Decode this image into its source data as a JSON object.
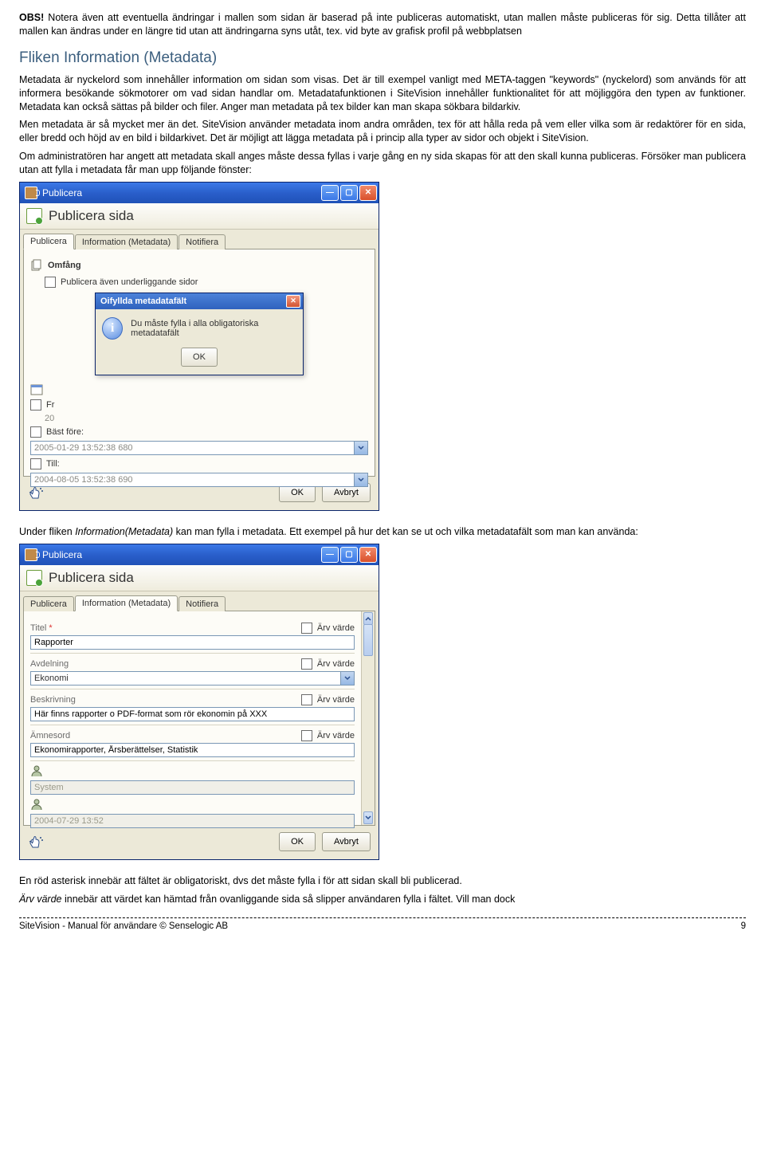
{
  "doc": {
    "p_obs_strong": "OBS!",
    "p_obs_rest": " Notera även att eventuella ändringar i mallen som sidan är baserad på inte publiceras automatiskt, utan mallen måste publiceras för sig. Detta tillåter att mallen kan ändras under en längre tid utan att ändringarna syns utåt, tex. vid byte av grafisk profil på webbplatsen",
    "h2_fliken": "Fliken Information (Metadata)",
    "p_meta_1": "Metadata är nyckelord som innehåller information om sidan som visas. Det är till exempel vanligt med META-taggen \"keywords\" (nyckelord) som används för att informera besökande sökmotorer om vad sidan handlar om. Metadatafunktionen i SiteVision innehåller funktionalitet för att möjliggöra den typen av funktioner. Metadata kan också sättas på bilder och filer. Anger man metadata på tex bilder kan man skapa sökbara bildarkiv.",
    "p_meta_2": "Men metadata är så mycket mer än det. SiteVision använder metadata inom andra områden, tex för att hålla reda på vem eller vilka som är redaktörer för en sida, eller bredd och höjd av en bild i bildarkivet. Det är möjligt att lägga metadata på i princip alla typer av sidor och objekt i SiteVision.",
    "p_meta_3": "Om administratören har angett att metadata skall anges måste dessa fyllas i varje gång en ny sida skapas för att den skall kunna publiceras. Försöker man publicera utan att fylla i metadata får man upp följande fönster:",
    "p_under_pre": "Under fliken ",
    "p_under_em": "Information(Metadata)",
    "p_under_post": " kan man fylla i metadata. Ett exempel på hur det kan se ut och vilka metadatafält som man kan använda:",
    "p_asterisk": "En röd asterisk innebär att fältet är obligatoriskt, dvs det måste fylla i för att sidan skall bli publicerad.",
    "p_arv_em": "Ärv värde",
    "p_arv_rest": " innebär att värdet kan hämtad från ovanliggande sida så slipper användaren fylla i fältet. Vill man dock"
  },
  "dialog": {
    "win_title": "Publicera",
    "sub_title": "Publicera sida",
    "tabs": {
      "publicera": "Publicera",
      "info": "Information (Metadata)",
      "notifiera": "Notifiera"
    },
    "omf_title": "Omfång",
    "publish_sub": "Publicera även underliggande sidor",
    "fr_label": "Fr",
    "fr_value": "20",
    "bast_label": "Bäst före:",
    "bast_value": "2005-01-29 13:52:38 680",
    "till_label": "Till:",
    "till_value": "2004-08-05 13:52:38 690",
    "ok": "OK",
    "cancel": "Avbryt"
  },
  "alert": {
    "title": "Oifyllda metadatafält",
    "msg": "Du måste fylla i alla obligatoriska metadatafält",
    "ok": "OK"
  },
  "dialog2": {
    "titel_lbl": "Titel",
    "titel_val": "Rapporter",
    "arv": "Ärv värde",
    "avd_lbl": "Avdelning",
    "avd_val": "Ekonomi",
    "besk_lbl": "Beskrivning",
    "besk_val": "Här finns rapporter o PDF-format som rör ekonomin på XXX",
    "amn_lbl": "Ämnesord",
    "amn_val": "Ekonomirapporter, Årsberättelser, Statistik",
    "sys_val": "System",
    "date_val": "2004-07-29 13:52"
  },
  "footer": {
    "left": "SiteVision - Manual för användare © Senselogic AB",
    "right": "9"
  }
}
